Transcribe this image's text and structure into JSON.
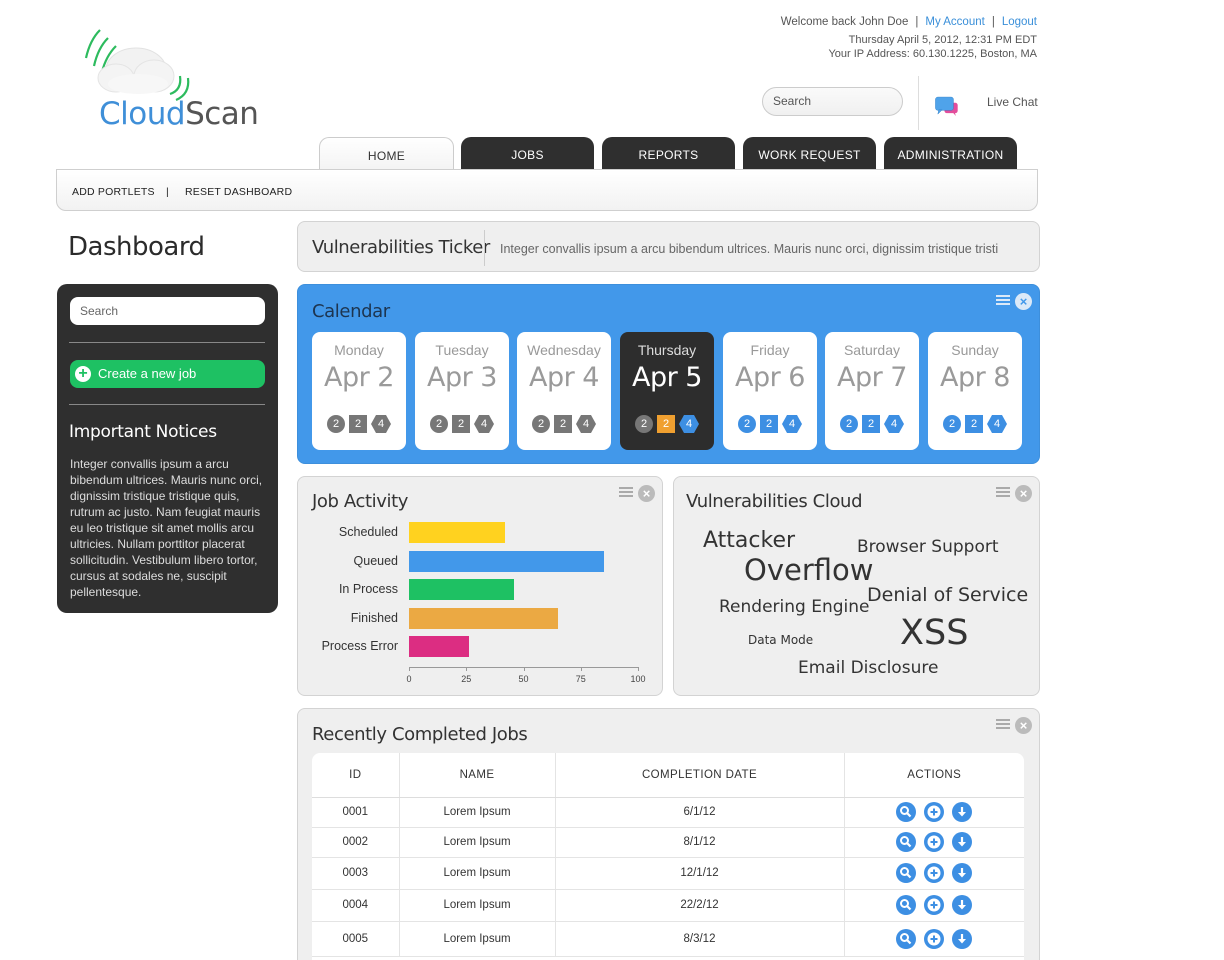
{
  "header": {
    "logo": {
      "part1": "Cloud",
      "part2": "Scan"
    },
    "welcome": "Welcome back John Doe",
    "my_account": "My Account",
    "logout": "Logout",
    "datetime": "Thursday April 5, 2012, 12:31 PM EDT",
    "ip": "Your IP Address: 60.130.1225, Boston, MA",
    "search_placeholder": "Search",
    "live_chat": "Live Chat"
  },
  "tabs": [
    {
      "label": "HOME",
      "active": true
    },
    {
      "label": "JOBS"
    },
    {
      "label": "REPORTS"
    },
    {
      "label": "WORK REQUEST"
    },
    {
      "label": "ADMINISTRATION"
    }
  ],
  "subbar": {
    "add_portlets": "ADD PORTLETS",
    "separator": "|",
    "reset_dashboard": "RESET DASHBOARD"
  },
  "sidebar": {
    "title": "Dashboard",
    "search_placeholder": "Search",
    "create_job": "Create a new job",
    "notices_title": "Important Notices",
    "notices_body": "Integer convallis ipsum a arcu bibendum ultrices. Mauris nunc orci, dignissim tristique tristique quis, rutrum ac justo. Nam feugiat mauris eu leo tristique sit amet mollis arcu ultricies. Nullam porttitor placerat sollicitudin. Vestibulum libero tortor, cursus at sodales ne, suscipit pellentesque."
  },
  "ticker": {
    "title": "Vulnerabilities Ticker",
    "text": "Integer convallis ipsum a arcu bibendum ultrices. Mauris nunc orci, dignissim tristique tristi"
  },
  "calendar": {
    "title": "Calendar",
    "days": [
      {
        "name": "Monday",
        "date": "Apr 2",
        "b1": "2",
        "b2": "2",
        "b3": "4"
      },
      {
        "name": "Tuesday",
        "date": "Apr 3",
        "b1": "2",
        "b2": "2",
        "b3": "4"
      },
      {
        "name": "Wednesday",
        "date": "Apr 4",
        "b1": "2",
        "b2": "2",
        "b3": "4"
      },
      {
        "name": "Thursday",
        "date": "Apr 5",
        "b1": "2",
        "b2": "2",
        "b3": "4",
        "active": true
      },
      {
        "name": "Friday",
        "date": "Apr 6",
        "b1": "2",
        "b2": "2",
        "b3": "4"
      },
      {
        "name": "Saturday",
        "date": "Apr 7",
        "b1": "2",
        "b2": "2",
        "b3": "4"
      },
      {
        "name": "Sunday",
        "date": "Apr 8",
        "b1": "2",
        "b2": "2",
        "b3": "4"
      }
    ]
  },
  "job_activity": {
    "title": "Job Activity"
  },
  "chart_data": {
    "type": "bar",
    "orientation": "horizontal",
    "categories": [
      "Scheduled",
      "Queued",
      "In Process",
      "Finished",
      "Process Error"
    ],
    "values": [
      42,
      85,
      46,
      65,
      26
    ],
    "colors": [
      "#ffd21f",
      "#4298ea",
      "#1ec163",
      "#eba943",
      "#dc2d82"
    ],
    "xlim": [
      0,
      100
    ],
    "xticks": [
      "0",
      "25",
      "50",
      "75",
      "100"
    ],
    "grid": false
  },
  "vuln_cloud": {
    "title": "Vulnerabilities Cloud",
    "words": [
      "Attacker",
      "Browser Support",
      "Overflow",
      "Denial of Service",
      "Rendering Engine",
      "XSS",
      "Data Mode",
      "Email Disclosure"
    ]
  },
  "jobs_table": {
    "title": "Recently Completed Jobs",
    "columns": [
      "ID",
      "NAME",
      "COMPLETION DATE",
      "ACTIONS"
    ],
    "rows": [
      {
        "id": "0001",
        "name": "Lorem Ipsum",
        "date": "6/1/12"
      },
      {
        "id": "0002",
        "name": "Lorem Ipsum",
        "date": "8/1/12"
      },
      {
        "id": "0003",
        "name": "Lorem Ipsum",
        "date": "12/1/12"
      },
      {
        "id": "0004",
        "name": "Lorem Ipsum",
        "date": "22/2/12"
      },
      {
        "id": "0005",
        "name": "Lorem Ipsum",
        "date": "8/3/12"
      }
    ]
  },
  "colors": {
    "accent": "#4298ea",
    "dark": "#2f2f2f",
    "green": "#1ec163",
    "orange": "#f0a030"
  }
}
